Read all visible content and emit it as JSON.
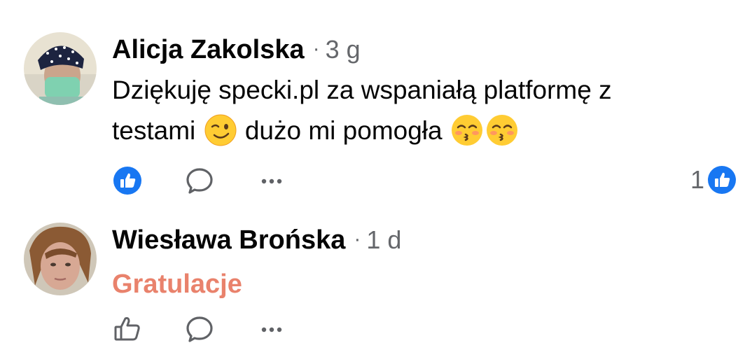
{
  "comments": [
    {
      "author": "Alicja Zakolska",
      "separator": "·",
      "time": "3 g",
      "text_line1": "Dziękuję specki.pl za wspaniałą platformę z",
      "text_line2_a": "testami",
      "text_line2_b": "dużo mi pomogła",
      "emojis": [
        "winking-face",
        "kissing-face-smiling-eyes",
        "kissing-face-smiling-eyes"
      ],
      "liked_by_viewer": true,
      "reaction_count": "1",
      "reaction_icon": "like-icon"
    },
    {
      "author": "Wiesława Brońska",
      "separator": "·",
      "time": "1 d",
      "text": "Gratulacje",
      "liked_by_viewer": false
    }
  ],
  "colors": {
    "brand_blue": "#1877f2",
    "secondary_text": "#65676b",
    "highlight_text": "#e9826c"
  }
}
